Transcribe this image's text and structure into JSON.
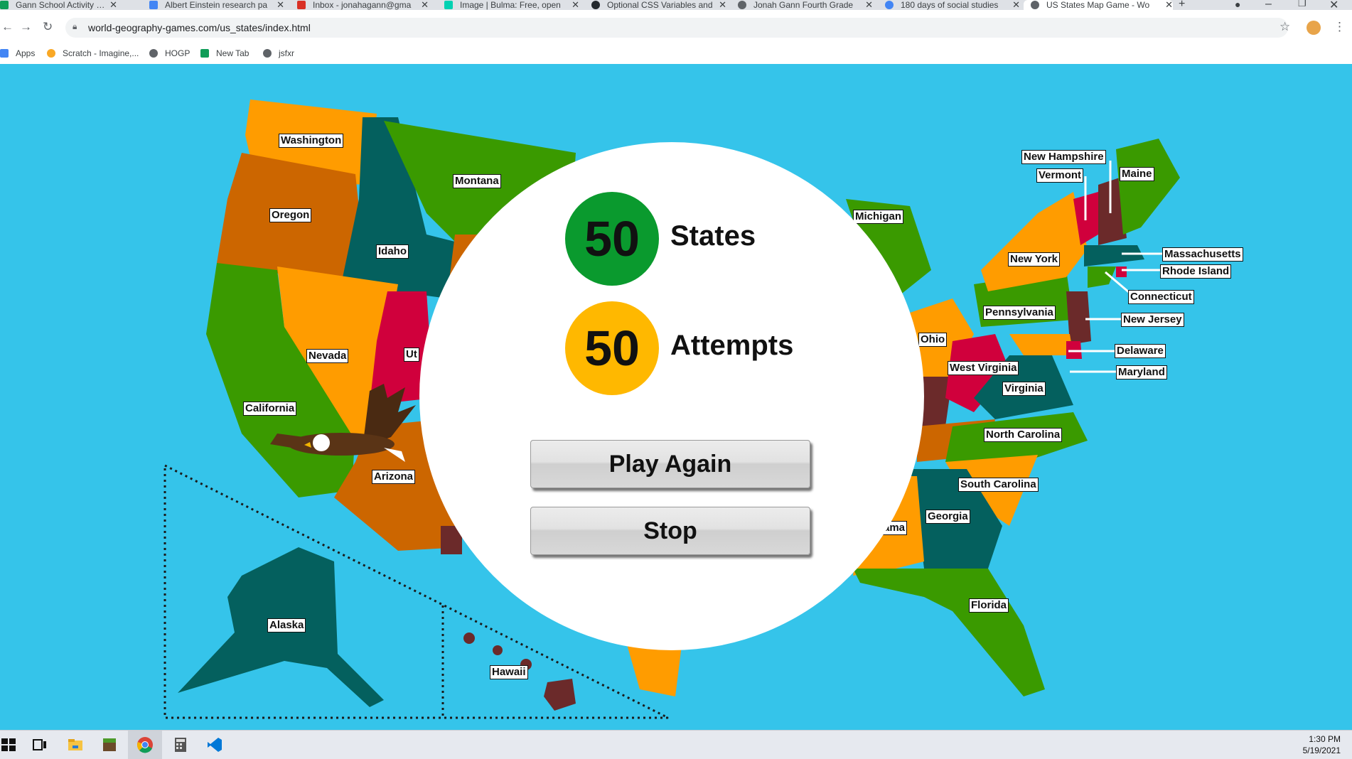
{
  "browser": {
    "tabs": [
      {
        "title": "Gann School Activity Log -",
        "color": "#0f9d58"
      },
      {
        "title": "Albert Einstein research pa",
        "color": "#4285f4"
      },
      {
        "title": "Inbox - jonahagann@gma",
        "color": "#d93025"
      },
      {
        "title": "Image | Bulma: Free, open",
        "color": "#00d1b2"
      },
      {
        "title": "Optional CSS Variables and",
        "color": "#24292e"
      },
      {
        "title": "Jonah Gann Fourth Grade",
        "color": "#5f6368"
      },
      {
        "title": "180 days of social studies",
        "color": "#4285f4"
      },
      {
        "title": "US States Map Game - Wo",
        "color": "#5f6368"
      }
    ],
    "new_tab": "+",
    "url": "world-geography-games.com/us_states/index.html",
    "bookmarks": [
      "Apps",
      "Scratch - Imagine,...",
      "HOGP",
      "New Tab",
      "jsfxr"
    ]
  },
  "states": [
    "Washington",
    "Oregon",
    "Idaho",
    "Montana",
    "Nevada",
    "California",
    "Utah",
    "Arizona",
    "Alaska",
    "Hawaii",
    "Michigan",
    "New York",
    "Pennsylvania",
    "Ohio",
    "West Virginia",
    "Virginia",
    "North Carolina",
    "South Carolina",
    "Georgia",
    "Florida",
    "Alabama",
    "New Hampshire",
    "Vermont",
    "Maine",
    "Massachusetts",
    "Rhode Island",
    "Connecticut",
    "New Jersey",
    "Delaware",
    "Maryland"
  ],
  "label_text": {
    "utah": "Ut",
    "alabama": "ama"
  },
  "result": {
    "states_count": "50",
    "states_label": "States",
    "attempts_count": "50",
    "attempts_label": "Attempts",
    "play_again": "Play Again",
    "stop": "Stop",
    "states_color": "#0a9a2e",
    "attempts_color": "#ffb800"
  },
  "map_colors": {
    "ocean": "#35c4ea",
    "orange": "#ff9c00",
    "dark_orange": "#cc6600",
    "teal": "#04605e",
    "green": "#3a9a00",
    "red": "#d0003c",
    "maroon": "#6b2a2a"
  },
  "taskbar": {
    "time": "1:30 PM",
    "date": "5/19/2021",
    "icons": [
      "windows-start-icon",
      "task-view-icon",
      "file-explorer-icon",
      "minecraft-icon",
      "chrome-icon",
      "calculator-icon",
      "vscode-icon"
    ]
  }
}
